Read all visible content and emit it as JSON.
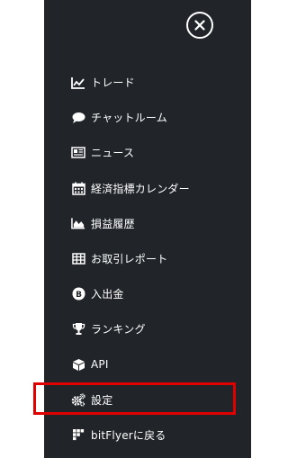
{
  "menu": {
    "close_icon": "close-circle-icon",
    "items": [
      {
        "id": "trade",
        "label": "トレード",
        "icon": "chart-line-icon"
      },
      {
        "id": "chat",
        "label": "チャットルーム",
        "icon": "speech-bubble-icon"
      },
      {
        "id": "news",
        "label": "ニュース",
        "icon": "newspaper-icon"
      },
      {
        "id": "calendar",
        "label": "経済指標カレンダー",
        "icon": "calendar-icon"
      },
      {
        "id": "pnl",
        "label": "損益履歴",
        "icon": "chart-area-icon"
      },
      {
        "id": "report",
        "label": "お取引レポート",
        "icon": "table-icon"
      },
      {
        "id": "deposit",
        "label": "入出金",
        "icon": "bitcoin-icon"
      },
      {
        "id": "ranking",
        "label": "ランキング",
        "icon": "trophy-icon"
      },
      {
        "id": "api",
        "label": "API",
        "icon": "cube-icon"
      },
      {
        "id": "settings",
        "label": "設定",
        "icon": "gears-icon"
      },
      {
        "id": "back",
        "label": "bitFlyerに戻る",
        "icon": "bitflyer-logo-icon"
      }
    ],
    "highlighted_item": "settings"
  },
  "colors": {
    "panel_background": "#212529",
    "page_background": "#ffffff",
    "text": "#ffffff",
    "highlight_border": "#e00000"
  }
}
